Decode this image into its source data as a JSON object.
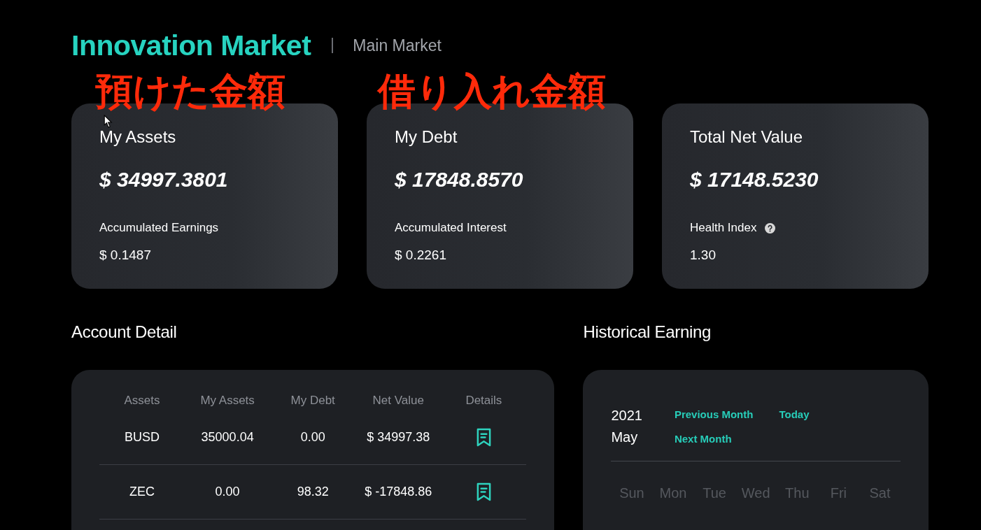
{
  "header": {
    "title": "Innovation Market",
    "subtitle": "Main Market"
  },
  "annotations": [
    "預けた金額",
    "借り入れ金額"
  ],
  "cards": [
    {
      "title": "My Assets",
      "value": "$ 34997.3801",
      "label": "Accumulated Earnings",
      "label_info": false,
      "amount": "$ 0.1487"
    },
    {
      "title": "My Debt",
      "value": "$ 17848.8570",
      "label": "Accumulated Interest",
      "label_info": false,
      "amount": "$ 0.2261"
    },
    {
      "title": "Total Net Value",
      "value": "$ 17148.5230",
      "label": "Health Index",
      "label_info": true,
      "amount": "1.30"
    }
  ],
  "account_detail": {
    "title": "Account Detail",
    "columns": [
      "Assets",
      "My Assets",
      "My Debt",
      "Net Value",
      "Details"
    ],
    "rows": [
      {
        "asset": "BUSD",
        "my_assets": "35000.04",
        "my_debt": "0.00",
        "net_value": "$ 34997.38"
      },
      {
        "asset": "ZEC",
        "my_assets": "0.00",
        "my_debt": "98.32",
        "net_value": "$ -17848.86"
      }
    ]
  },
  "historical_earning": {
    "title": "Historical Earning",
    "year": "2021",
    "month": "May",
    "links": [
      "Previous Month",
      "Today",
      "Next Month"
    ],
    "weekdays": [
      "Sun",
      "Mon",
      "Tue",
      "Wed",
      "Thu",
      "Fri",
      "Sat"
    ]
  }
}
